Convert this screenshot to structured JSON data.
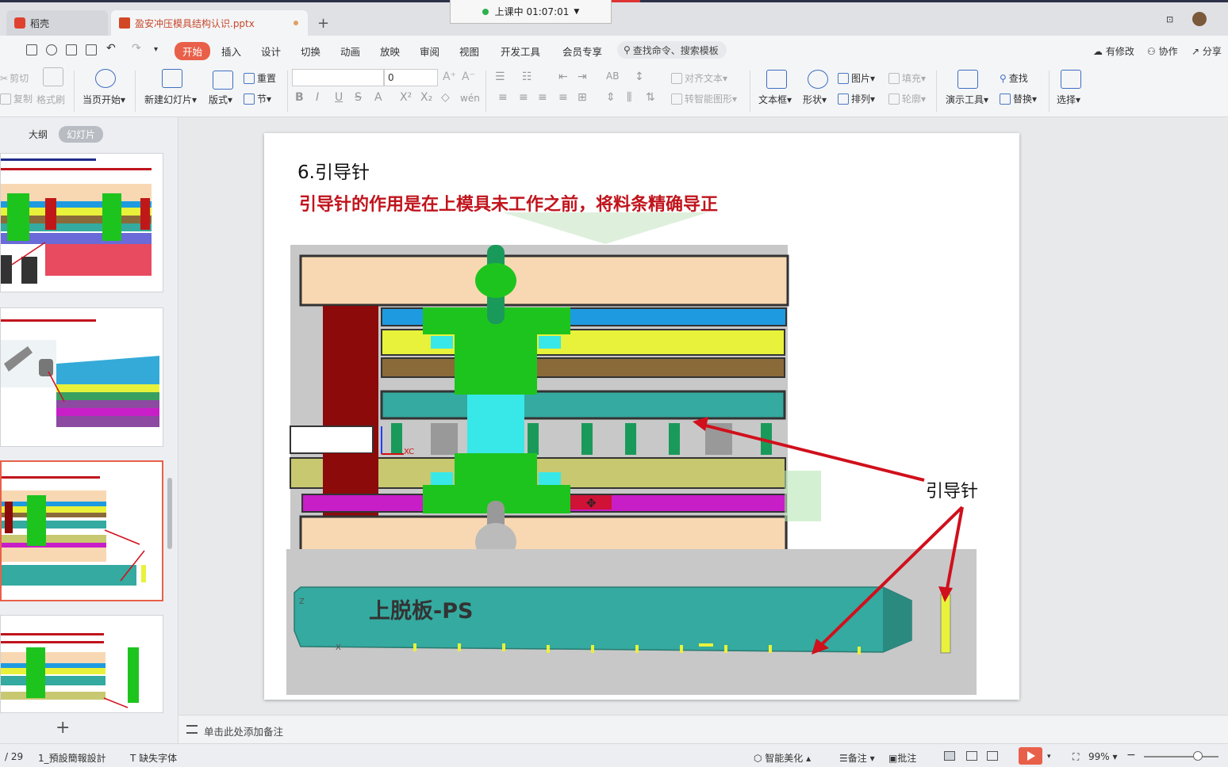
{
  "tabs": {
    "home_tab": "稻壳",
    "doc_tab": "盈安冲压模具结构认识.pptx",
    "new_tab_symbol": "+"
  },
  "live": {
    "status": "上课中 01:07:01"
  },
  "menu": {
    "items": [
      "开始",
      "插入",
      "设计",
      "切换",
      "动画",
      "放映",
      "审阅",
      "视图",
      "开发工具",
      "会员专享"
    ],
    "search_placeholder": "查找命令、搜索模板",
    "right": [
      "有修改",
      "协作",
      "分享"
    ]
  },
  "ribbon": {
    "clipboard": [
      "剪切",
      "复制",
      "格式刷"
    ],
    "play_from_current": "当页开始",
    "new_slide": "新建幻灯片",
    "layout": "版式",
    "reset": "重置",
    "section": "节",
    "font_size": "0",
    "align_text": "对齐文本",
    "to_smartart": "转智能图形",
    "textbox": "文本框",
    "shape": "形状",
    "picture": "图片",
    "arrange": "排列",
    "fill": "填充",
    "outline": "轮廓",
    "presenter_tools": "演示工具",
    "find": "查找",
    "replace": "替换",
    "select": "选择"
  },
  "left_panel": {
    "tab_outline": "大纲",
    "tab_slides": "幻灯片",
    "add_symbol": "+"
  },
  "slide": {
    "title": "6.引导针",
    "subtitle": "引导针的作用是在上模具未工作之前，将料条精确导正",
    "callout": "引导针",
    "plate_label": "上脱板-PS",
    "axis_x": "XC",
    "axis_z": "Z",
    "axis_x2": "X"
  },
  "notes": {
    "placeholder": "单击此处添加备注"
  },
  "status": {
    "page": "/ 29",
    "theme": "1_預設簡報設計",
    "missing_font": "缺失字体",
    "beautify": "智能美化",
    "notes_btn": "备注",
    "comments_btn": "批注",
    "zoom": "99%"
  },
  "colors": {
    "accent": "#e9604a",
    "subtitle_red": "#c0141c",
    "plate_peach": "#f8d8b2",
    "plate_green": "#1ec41e",
    "plate_teal": "#34aaa0",
    "plate_yellow": "#e8f23a",
    "plate_blue": "#1e9be0",
    "plate_magenta": "#c81ec8",
    "plate_darkred": "#8c0a0a",
    "arrow_red": "#d0101c"
  }
}
